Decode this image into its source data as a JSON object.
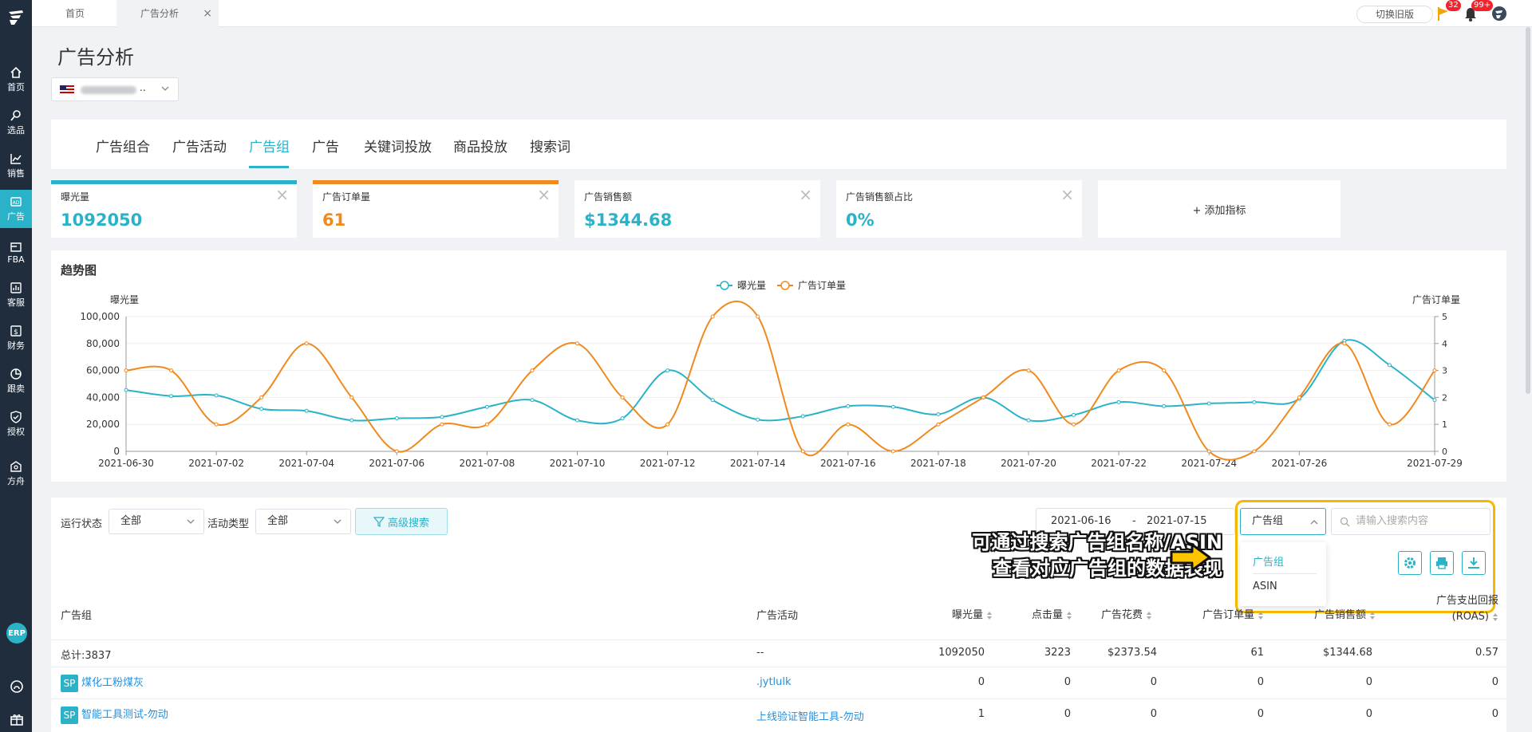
{
  "sidebar": {
    "items": [
      {
        "label": "首页",
        "icon": "home-icon"
      },
      {
        "label": "选品",
        "icon": "search-icon"
      },
      {
        "label": "销售",
        "icon": "chart-line-icon"
      },
      {
        "label": "广告",
        "icon": "ad-icon"
      },
      {
        "label": "FBA",
        "icon": "fba-icon"
      },
      {
        "label": "客服",
        "icon": "service-icon"
      },
      {
        "label": "财务",
        "icon": "finance-icon"
      },
      {
        "label": "跟卖",
        "icon": "pie-icon"
      },
      {
        "label": "授权",
        "icon": "shield-icon"
      },
      {
        "label": "方舟",
        "icon": "ark-icon"
      }
    ],
    "erp": "ERP"
  },
  "topbar": {
    "tabs": [
      {
        "label": "首页"
      },
      {
        "label": "广告分析"
      }
    ],
    "close": "×",
    "old_version": "切换旧版",
    "flag_badge": "32",
    "bell_badge": "99+"
  },
  "page": {
    "title": "广告分析",
    "store_suffix": ".."
  },
  "nav_tabs": [
    "广告组合",
    "广告活动",
    "广告组",
    "广告",
    "关键词投放",
    "商品投放",
    "搜索词"
  ],
  "metrics": [
    {
      "label": "曝光量",
      "value": "1092050",
      "color": "#2ab3c8"
    },
    {
      "label": "广告订单量",
      "value": "61",
      "color": "#f0891e"
    },
    {
      "label": "广告销售额",
      "value": "$1344.68",
      "color": "#2ab3c8"
    },
    {
      "label": "广告销售额占比",
      "value": "0%",
      "color": "#2ab3c8"
    }
  ],
  "add_metric": "+ 添加指标",
  "trend": {
    "title": "趋势图"
  },
  "chart_data": {
    "type": "line",
    "x": [
      "2021-06-30",
      "2021-07-01",
      "2021-07-02",
      "2021-07-03",
      "2021-07-04",
      "2021-07-05",
      "2021-07-06",
      "2021-07-07",
      "2021-07-08",
      "2021-07-09",
      "2021-07-10",
      "2021-07-11",
      "2021-07-12",
      "2021-07-13",
      "2021-07-14",
      "2021-07-15",
      "2021-07-16",
      "2021-07-17",
      "2021-07-18",
      "2021-07-19",
      "2021-07-20",
      "2021-07-21",
      "2021-07-22",
      "2021-07-23",
      "2021-07-24",
      "2021-07-25",
      "2021-07-26",
      "2021-07-27",
      "2021-07-28",
      "2021-07-29"
    ],
    "xticks": [
      "2021-06-30",
      "2021-07-02",
      "2021-07-04",
      "2021-07-06",
      "2021-07-08",
      "2021-07-10",
      "2021-07-12",
      "2021-07-14",
      "2021-07-16",
      "2021-07-18",
      "2021-07-20",
      "2021-07-22",
      "2021-07-24",
      "2021-07-26",
      "2021-07-29"
    ],
    "series": [
      {
        "name": "曝光量",
        "axis": "left",
        "color": "#2ab3c8",
        "values": [
          45500,
          41000,
          41500,
          31500,
          30000,
          23000,
          24500,
          25500,
          33000,
          38000,
          23000,
          24500,
          60000,
          38000,
          23500,
          26000,
          33500,
          33000,
          27500,
          40000,
          23000,
          27000,
          36500,
          33500,
          35500,
          36500,
          39000,
          82000,
          64000,
          38000
        ]
      },
      {
        "name": "广告订单量",
        "axis": "right",
        "color": "#f0891e",
        "values": [
          3,
          3,
          1,
          2,
          4,
          2,
          0,
          1,
          1,
          3,
          4,
          2,
          1,
          5,
          5,
          0,
          1,
          0,
          1,
          2,
          3,
          1,
          3,
          3,
          0,
          0,
          2,
          4,
          1,
          3
        ]
      }
    ],
    "ylabel_left": "曝光量",
    "ylabel_right": "广告订单量",
    "ylim_left": [
      0,
      100000
    ],
    "ylim_right": [
      0,
      5
    ],
    "yticks_left": [
      "0",
      "20,000",
      "40,000",
      "60,000",
      "80,000",
      "100,000"
    ],
    "yticks_right": [
      "0",
      "1",
      "2",
      "3",
      "4",
      "5"
    ],
    "legend": "top-center",
    "grid": true
  },
  "filters": {
    "run_status_label": "运行状态",
    "run_status_value": "全部",
    "campaign_type_label": "活动类型",
    "campaign_type_value": "全部",
    "advanced": "高级搜索",
    "date_start": "2021-06-16",
    "date_sep": "-",
    "date_end": "2021-07-15",
    "search_type": "广告组",
    "search_placeholder": "请输入搜索内容",
    "dropdown": [
      "广告组",
      "ASIN"
    ]
  },
  "annotation": {
    "line1": "可通过搜索广告组名称/ASIN",
    "line2": "查看对应广告组的数据表现"
  },
  "table": {
    "headers": [
      "广告组",
      "广告活动",
      "曝光量",
      "点击量",
      "广告花费",
      "广告订单量",
      "广告销售额",
      "广告支出回报",
      "(ROAS)"
    ],
    "total": {
      "group": "总计:3837",
      "campaign": "--",
      "impressions": "1092050",
      "clicks": "3223",
      "spend": "$2373.54",
      "orders": "61",
      "sales": "$1344.68",
      "roas": "0.57"
    },
    "rows": [
      {
        "badge": "SP",
        "group": "煤化工粉煤灰",
        "campaign": ".jytlulk",
        "impressions": "0",
        "clicks": "0",
        "spend": "0",
        "orders": "0",
        "sales": "0",
        "roas": "0"
      },
      {
        "badge": "SP",
        "group": "智能工具测试-勿动",
        "campaign": "上线验证智能工具-勿动",
        "impressions": "1",
        "clicks": "0",
        "spend": "0",
        "orders": "0",
        "sales": "0",
        "roas": "0"
      }
    ]
  }
}
